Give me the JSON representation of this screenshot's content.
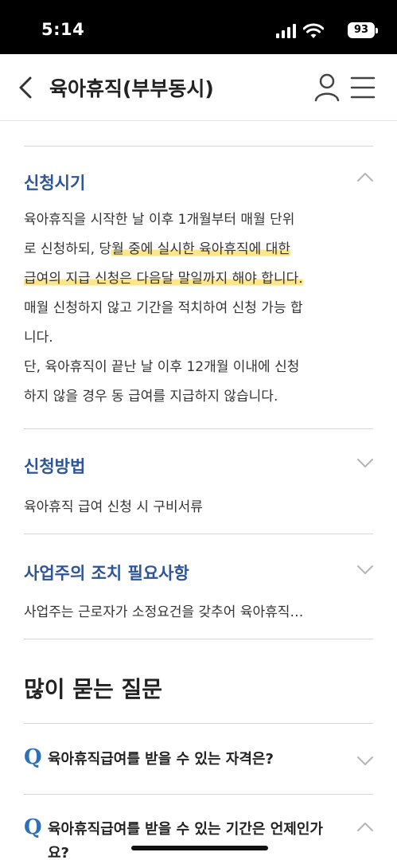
{
  "status": {
    "time": "5:14",
    "battery": "93"
  },
  "header": {
    "title": "육아휴직(부부동시)"
  },
  "sections": [
    {
      "title": "신청시기",
      "body_lines": [
        "육아휴직을 시작한 날 이후 1개월부터 매월 단위",
        "로 신청하되, 당",
        "월 중에 실시한 육아휴직에 대한",
        "급여의 지급 신청은 다음달 말일까지 해야 합니다.",
        "매월 신청하지 않고 기간을 적치하여 신청 가능 합",
        "니다.",
        "단, 육아휴직이 끝난 날 이후 12개월 이내에 신청",
        "하지 않을 경우 동 급여를 지급하지 않습니다."
      ]
    },
    {
      "title": "신청방법",
      "summary": "육아휴직 급여 신청 시 구비서류"
    },
    {
      "title": "사업주의 조치 필요사항",
      "summary": "사업주는 근로자가 소정요건을 갖추어 육아휴직…"
    }
  ],
  "faq": {
    "heading": "많이 묻는 질문",
    "q_mark": "Q",
    "items": [
      {
        "question": "육아휴직급여를 받을 수 있는 자격은?"
      },
      {
        "question": "육아휴직급여를 받을 수 있는 기간은 언제인가요?"
      }
    ]
  }
}
